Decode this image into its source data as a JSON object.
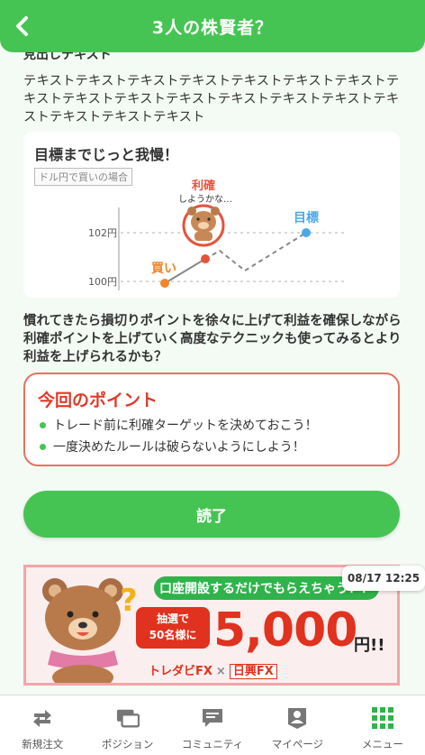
{
  "header": {
    "title": "3人の株賢者？",
    "back_icon": "chevron-left-icon"
  },
  "content": {
    "section_heading": "見出しテキスト",
    "body_text": "テキストテキストテキストテキストテキストテキストテキストテキストテキストテキストテキストテキストテキストテキストテキストテキストテキストテキスト",
    "chart_card": {
      "title": "目標までじっと我慢！",
      "tag": "ドル円で買いの場合",
      "labels": {
        "buy": "買い",
        "take_profit": "利確",
        "thinking": "しようかな…",
        "target": "目標",
        "price_102": "102円",
        "price_100": "100円"
      },
      "colors": {
        "buy": "#f0862a",
        "take_profit": "#e5533d",
        "target": "#4aa8e8"
      }
    },
    "description": "慣れてきたら損切りポイントを徐々に上げて利益を確保しながら利確ポイントを上げていく高度なテクニックも使ってみるとより利益を上げられるかも？",
    "point_box": {
      "title": "今回のポイント",
      "items": [
        "トレード前に利確ターゲットを決めておこう！",
        "一度決めたルールは破らないようにしよう！"
      ]
    },
    "done_button": "読了",
    "banner": {
      "headline": "口座開設するだけでもらえちゃう！？",
      "badge_line1": "抽選で",
      "badge_line2": "50名様に",
      "amount": "5,000",
      "unit": "円!!",
      "brand1": "トレダビFX",
      "brand_sep": "×",
      "brand2": "日興FX"
    },
    "timestamp": "08/17 12:25"
  },
  "bottom_nav": [
    {
      "label": "新規注文",
      "icon": "swap-arrows-icon"
    },
    {
      "label": "ポジション",
      "icon": "cards-icon"
    },
    {
      "label": "コミュニティ",
      "icon": "chat-bubble-icon"
    },
    {
      "label": "マイページ",
      "icon": "user-badge-icon"
    },
    {
      "label": "メニュー",
      "icon": "grid-menu-icon"
    }
  ]
}
